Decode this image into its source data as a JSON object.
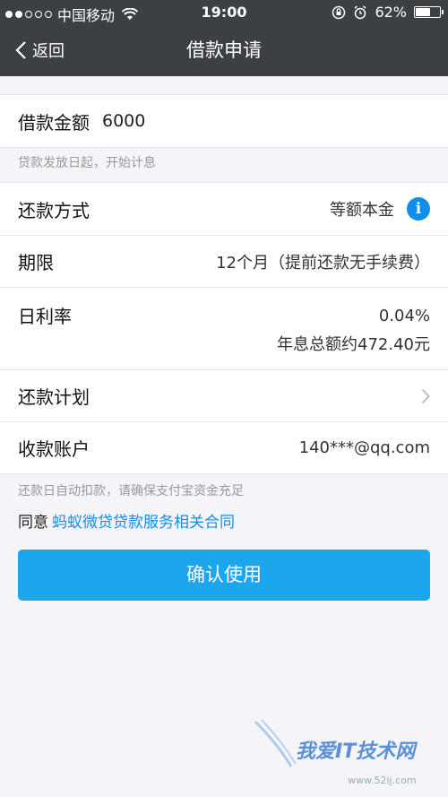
{
  "status_bar": {
    "carrier": "中国移动",
    "time": "19:00",
    "battery": "62%",
    "battery_level": 0.62,
    "signal_bars_on": 2,
    "signal_bars_total": 5
  },
  "nav": {
    "back_label": "返回",
    "title": "借款申请"
  },
  "loan": {
    "amount_label": "借款金额",
    "amount_value": "6000",
    "amount_note": "贷款发放日起，开始计息"
  },
  "details": {
    "repay_method_label": "还款方式",
    "repay_method_value": "等额本金",
    "term_label": "期限",
    "term_value": "12个月（提前还款无手续费）",
    "rate_label": "日利率",
    "rate_value": "0.04%",
    "interest_total": "年息总额约472.40元",
    "plan_label": "还款计划",
    "account_label": "收款账户",
    "account_value": "140***@qq.com"
  },
  "footer_note": "还款日自动扣款，请确保支付宝资金充足",
  "agreement": {
    "prefix": "同意",
    "link": "蚂蚁微贷贷款服务相关合同"
  },
  "confirm_button": "确认使用",
  "watermark": {
    "text": "我爱IT技术网",
    "sub": "www.52ij.com"
  },
  "colors": {
    "header_bg": "#3c4044",
    "accent": "#108ee9",
    "button": "#1ba6ee"
  }
}
